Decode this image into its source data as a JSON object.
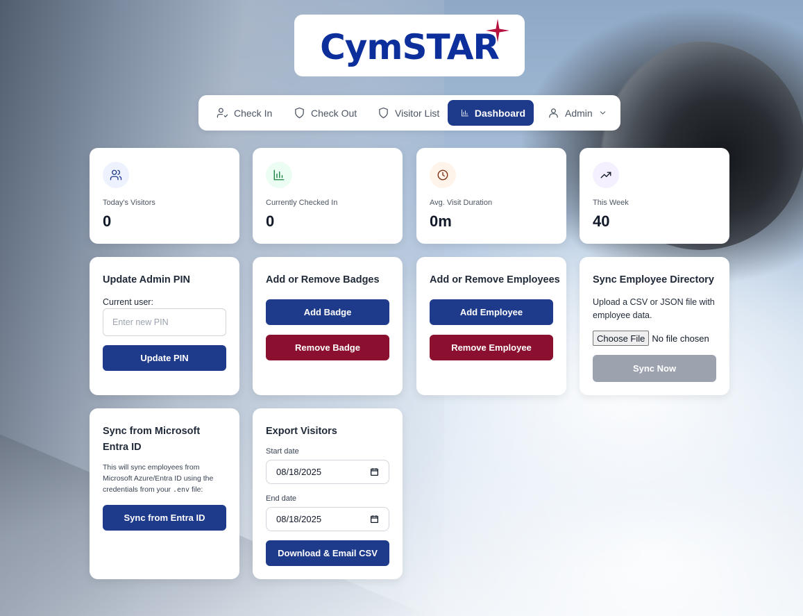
{
  "brand": {
    "logo_text": "CymSTAR",
    "star_color": "#b5123f",
    "text_color": "#0d2f9c"
  },
  "nav": {
    "items": [
      {
        "label": "Check In",
        "icon": "user-check-icon"
      },
      {
        "label": "Check Out",
        "icon": "shield-icon"
      },
      {
        "label": "Visitor List",
        "icon": "shield-icon"
      },
      {
        "label": "Dashboard",
        "icon": "bar-chart-icon",
        "active": true
      },
      {
        "label": "Admin",
        "icon": "user-icon",
        "dropdown": true
      }
    ],
    "active_color": "#1e3a8a"
  },
  "stats": [
    {
      "label": "Today's Visitors",
      "value": "0",
      "icon": "users-icon",
      "icon_color": "#1e3a8a",
      "icon_bg": "#eef2ff"
    },
    {
      "label": "Currently Checked In",
      "value": "0",
      "icon": "bar-chart-icon",
      "icon_color": "#15803d",
      "icon_bg": "#ecfdf3"
    },
    {
      "label": "Avg. Visit Duration",
      "value": "0m",
      "icon": "clock-icon",
      "icon_color": "#7c2d12",
      "icon_bg": "#fff4ea"
    },
    {
      "label": "This Week",
      "value": "40",
      "icon": "trending-up-icon",
      "icon_color": "#111827",
      "icon_bg": "#f5f0ff"
    }
  ],
  "pin_card": {
    "title": "Update Admin PIN",
    "current_user_label": "Current user:",
    "pin_placeholder": "Enter new PIN",
    "button": "Update PIN"
  },
  "badges_card": {
    "title": "Add or Remove Badges",
    "add_button": "Add Badge",
    "remove_button": "Remove Badge"
  },
  "employees_card": {
    "title": "Add or Remove Employees",
    "add_button": "Add Employee",
    "remove_button": "Remove Employee"
  },
  "directory_card": {
    "title": "Sync Employee Directory",
    "description": "Upload a CSV or JSON file with employee data.",
    "choose_file": "Choose File",
    "no_file": "No file chosen",
    "button": "Sync Now"
  },
  "entra_card": {
    "title": "Sync from Microsoft Entra ID",
    "description_before": "This will sync employees from Microsoft Azure/Entra ID using the credentials from your",
    "description_code": ".env",
    "description_after": "file:",
    "button": "Sync from Entra ID"
  },
  "export_card": {
    "title": "Export Visitors",
    "start_label": "Start date",
    "start_value": "08/18/2025",
    "end_label": "End date",
    "end_value": "08/18/2025",
    "button": "Download & Email CSV"
  },
  "colors": {
    "primary": "#1e3a8a",
    "danger": "#8b1030",
    "disabled": "#9ca3af"
  }
}
